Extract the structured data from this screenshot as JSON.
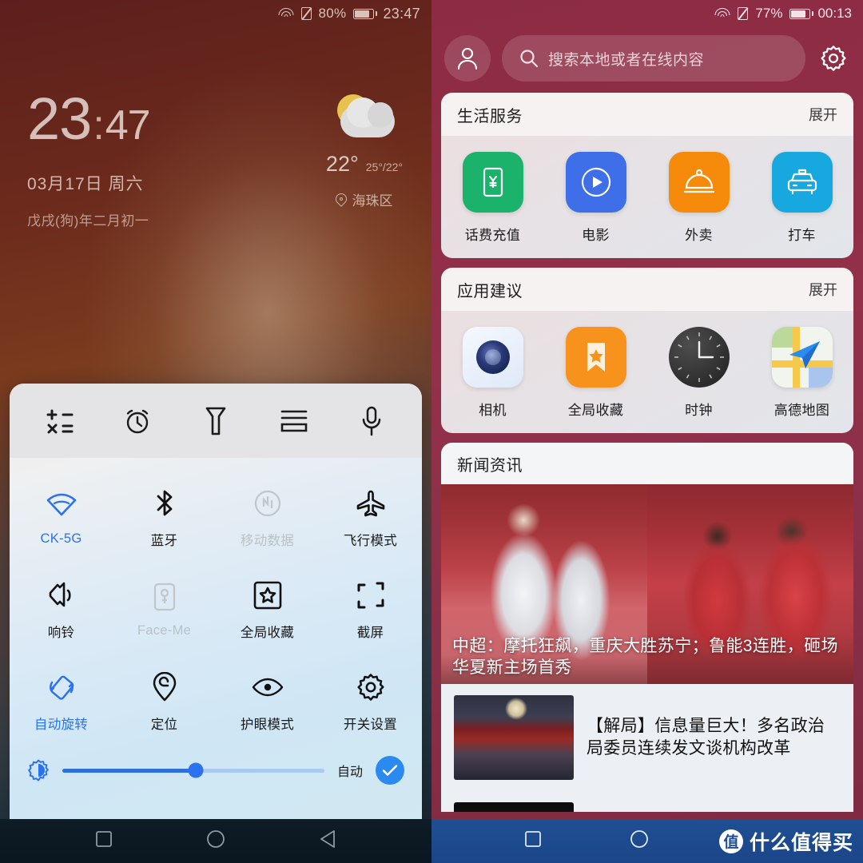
{
  "left": {
    "status": {
      "wifi_icon": "wifi-icon",
      "sim_icon": "no-sim-icon",
      "battery_pct": "80%",
      "battery_icon": "battery-icon",
      "clock": "23:47"
    },
    "lock": {
      "hours": "23",
      "separator": ":",
      "minutes": "47",
      "date": "03月17日 周六",
      "lunar": "戊戌(狗)年二月初一",
      "weather_icon": "sun-behind-cloud-icon",
      "temp": "22°",
      "temp_range": "25°/22°",
      "location_icon": "location-pin-icon",
      "location": "海珠区"
    },
    "quick_settings": {
      "shortcuts": [
        {
          "name": "calculator-icon",
          "label": "计算器"
        },
        {
          "name": "alarm-icon",
          "label": "闹钟"
        },
        {
          "name": "flashlight-icon",
          "label": "手电筒"
        },
        {
          "name": "split-screen-icon",
          "label": "分屏"
        },
        {
          "name": "recorder-icon",
          "label": "录音"
        }
      ],
      "toggles": [
        {
          "label": "CK-5G",
          "icon": "wifi-icon",
          "state": "on"
        },
        {
          "label": "蓝牙",
          "icon": "bluetooth-icon",
          "state": "normal"
        },
        {
          "label": "移动数据",
          "icon": "mobile-data-icon",
          "state": "off"
        },
        {
          "label": "飞行模式",
          "icon": "airplane-icon",
          "state": "normal"
        },
        {
          "label": "响铃",
          "icon": "ringer-icon",
          "state": "normal"
        },
        {
          "label": "Face-Me",
          "icon": "face-me-icon",
          "state": "off"
        },
        {
          "label": "全局收藏",
          "icon": "star-box-icon",
          "state": "normal"
        },
        {
          "label": "截屏",
          "icon": "screenshot-icon",
          "state": "normal"
        },
        {
          "label": "自动旋转",
          "icon": "auto-rotate-icon",
          "state": "on"
        },
        {
          "label": "定位",
          "icon": "location-pin-icon",
          "state": "normal"
        },
        {
          "label": "护眼模式",
          "icon": "eye-comfort-icon",
          "state": "normal"
        },
        {
          "label": "开关设置",
          "icon": "gear-icon",
          "state": "normal"
        }
      ],
      "brightness": {
        "icon": "brightness-icon",
        "value_pct": 51,
        "auto_label": "自动",
        "auto_checked": true,
        "check_icon": "check-icon",
        "accent": "#2b72f0"
      }
    },
    "navbar": {
      "recents_icon": "square-icon",
      "home_icon": "circle-icon",
      "back_icon": "triangle-back-icon"
    }
  },
  "right": {
    "status": {
      "wifi_icon": "wifi-icon",
      "sim_icon": "no-sim-icon",
      "battery_pct": "77%",
      "battery_icon": "battery-icon",
      "clock": "00:13"
    },
    "header": {
      "avatar_icon": "user-avatar-icon",
      "search_icon": "search-icon",
      "search_placeholder": "搜索本地或者在线内容",
      "gear_icon": "gear-icon"
    },
    "cards": [
      {
        "title": "生活服务",
        "action": "展开",
        "apps": [
          {
            "name": "话费充值",
            "icon": "phone-recharge-icon",
            "color": "#1bb36b"
          },
          {
            "name": "电影",
            "icon": "movie-play-icon",
            "color": "#3f6fe8"
          },
          {
            "name": "外卖",
            "icon": "food-delivery-icon",
            "color": "#f58a0b"
          },
          {
            "name": "打车",
            "icon": "taxi-icon",
            "color": "#18a8e0"
          }
        ]
      },
      {
        "title": "应用建议",
        "action": "展开",
        "apps": [
          {
            "name": "相机",
            "icon": "camera-icon",
            "color": "#e8eef8"
          },
          {
            "name": "全局收藏",
            "icon": "bookmark-star-icon",
            "color": "#f7931d"
          },
          {
            "name": "时钟",
            "icon": "clock-icon",
            "color": "#3b3b3b"
          },
          {
            "name": "高德地图",
            "icon": "amap-icon",
            "color": "#eef2e6"
          }
        ]
      }
    ],
    "news": {
      "title": "新闻资讯",
      "hero_caption": "中超：摩托狂飙，重庆大胜苏宁；鲁能3连胜，砸场华夏新主场首秀",
      "items": [
        {
          "title": "【解局】信息量巨大！多名政治局委员连续发文谈机构改革",
          "thumb": "news-thumbnail"
        },
        {
          "title": "",
          "thumb": "news-thumbnail"
        }
      ]
    },
    "navbar": {
      "recents_icon": "square-icon",
      "home_icon": "circle-icon"
    },
    "watermark": {
      "badge": "值",
      "text": "什么值得买"
    }
  }
}
